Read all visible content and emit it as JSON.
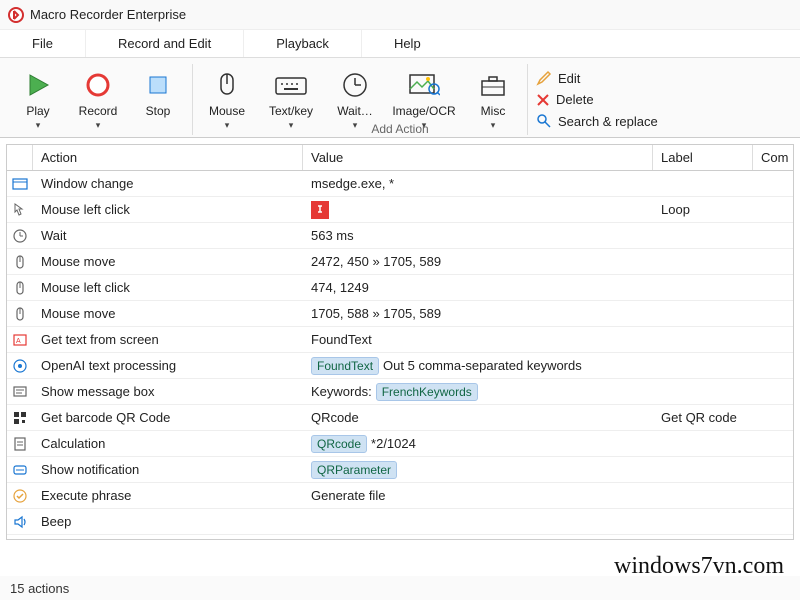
{
  "app": {
    "title": "Macro Recorder Enterprise"
  },
  "menu": {
    "file": "File",
    "record_edit": "Record and Edit",
    "playback": "Playback",
    "help": "Help"
  },
  "ribbon": {
    "play": "Play",
    "record": "Record",
    "stop": "Stop",
    "mouse": "Mouse",
    "textkey": "Text/key",
    "wait": "Wait…",
    "imageocr": "Image/OCR",
    "misc": "Misc",
    "add_action": "Add Action"
  },
  "side": {
    "edit": "Edit",
    "delete": "Delete",
    "search_replace": "Search & replace"
  },
  "cols": {
    "action": "Action",
    "value": "Value",
    "label": "Label",
    "com": "Com"
  },
  "rows": [
    {
      "icon": "window",
      "action": "Window change",
      "value_text": "msedge.exe, *",
      "label": ""
    },
    {
      "icon": "click",
      "action": "Mouse left click",
      "value_icon": "redsq",
      "label": "Loop"
    },
    {
      "icon": "clock",
      "action": "Wait",
      "value_text": "563 ms",
      "label": ""
    },
    {
      "icon": "mouse",
      "action": "Mouse move",
      "value_text": "2472, 450 » 1705, 589",
      "label": ""
    },
    {
      "icon": "mouse",
      "action": "Mouse left click",
      "value_text": "474, 1249",
      "label": ""
    },
    {
      "icon": "mouse",
      "action": "Mouse move",
      "value_text": "1705, 588 » 1705, 589",
      "label": ""
    },
    {
      "icon": "ocr",
      "action": "Get text from screen",
      "value_text": "FoundText",
      "label": ""
    },
    {
      "icon": "ai",
      "action": "OpenAI text processing",
      "chips": [
        "FoundText"
      ],
      "value_after": "Out 5 comma-separated keywords",
      "label": ""
    },
    {
      "icon": "msgbox",
      "action": "Show message box",
      "value_prefix": "Keywords:",
      "chips": [
        "FrenchKeywords"
      ],
      "label": ""
    },
    {
      "icon": "qr",
      "action": "Get barcode QR Code",
      "value_text": "QRcode",
      "label": "Get QR code"
    },
    {
      "icon": "calc",
      "action": "Calculation",
      "chips": [
        "QRcode"
      ],
      "value_after": "*2/1024",
      "label": ""
    },
    {
      "icon": "notify",
      "action": "Show notification",
      "chips": [
        "QRParameter"
      ],
      "label": ""
    },
    {
      "icon": "phrase",
      "action": "Execute phrase",
      "value_text": "Generate file",
      "label": ""
    },
    {
      "icon": "beep",
      "action": "Beep",
      "value_text": "",
      "label": ""
    }
  ],
  "status": {
    "count_text": "15 actions"
  },
  "watermark": "windows7vn.com"
}
